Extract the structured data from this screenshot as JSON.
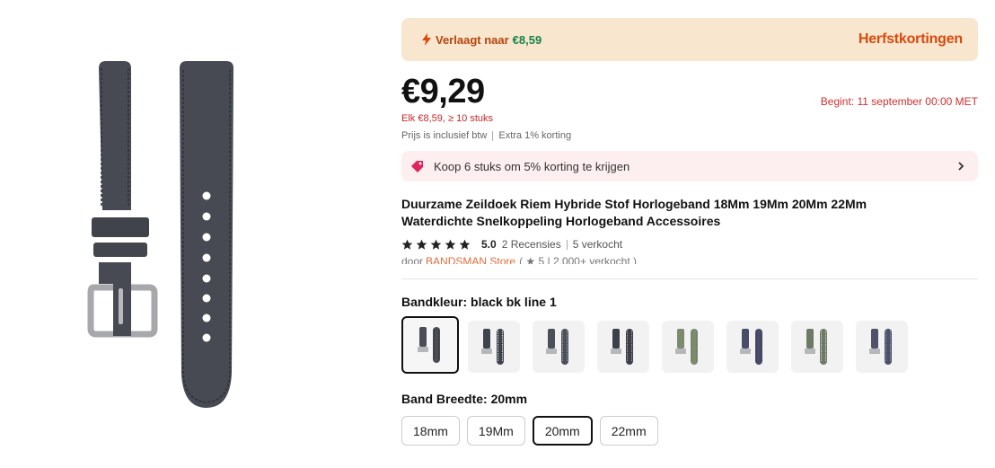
{
  "colors": {
    "banner_bg": "#f9e6cf",
    "brand_orange": "#d94a0b",
    "price_green": "#12834a",
    "red_text": "#c62828",
    "discount_bg": "#fdeef0"
  },
  "product_image": {
    "icon": "watch-strap-image"
  },
  "promo": {
    "icon": "lightning-icon",
    "reduced_label": "Verlaagt naar",
    "reduced_price": "€8,59",
    "campaign": "Herfstkortingen"
  },
  "pricing": {
    "price": "€9,29",
    "start_date": "Begint: 11 september 00:00 MET",
    "bulk_price": "Elk €8,59, ≥ 10 stuks",
    "tax_note": "Prijs is inclusief btw",
    "extra_discount": "Extra 1% korting"
  },
  "bundle_offer": {
    "icon": "tag-icon",
    "text": "Koop 6 stuks om 5% korting te krijgen"
  },
  "title": "Duurzame Zeildoek Riem Hybride Stof Horlogeband 18Mm 19Mm 20Mm 22Mm Waterdichte Snelkoppeling Horlogeband Accessoires",
  "rating": {
    "stars": 5,
    "score": "5.0",
    "reviews": "2 Recensies",
    "sold": "5 verkocht"
  },
  "seller": {
    "prefix": "door",
    "name": "BANDSMAN Store",
    "stats": "( ★ 5 | 2.000+ verkocht )"
  },
  "band_color": {
    "label": "Bandkleur: black bk line 1",
    "selected_index": 0,
    "options": [
      {
        "strap_color": "#4a4d55",
        "stitch": "#2c2e33"
      },
      {
        "strap_color": "#3f434c",
        "stitch": "#ffffff"
      },
      {
        "strap_color": "#4b4f57",
        "stitch": "#aab0b8"
      },
      {
        "strap_color": "#3c4048",
        "stitch": "#c9a7a7"
      },
      {
        "strap_color": "#7c8a6e",
        "stitch": "#6a775d"
      },
      {
        "strap_color": "#4a4d6a",
        "stitch": "#39394f"
      },
      {
        "strap_color": "#6f7a66",
        "stitch": "#dcdcdc"
      },
      {
        "strap_color": "#4e5167",
        "stitch": "#8fa4c8"
      }
    ]
  },
  "band_width": {
    "label": "Band Breedte: 20mm",
    "selected_index": 2,
    "options": [
      "18mm",
      "19Mm",
      "20mm",
      "22mm"
    ]
  }
}
